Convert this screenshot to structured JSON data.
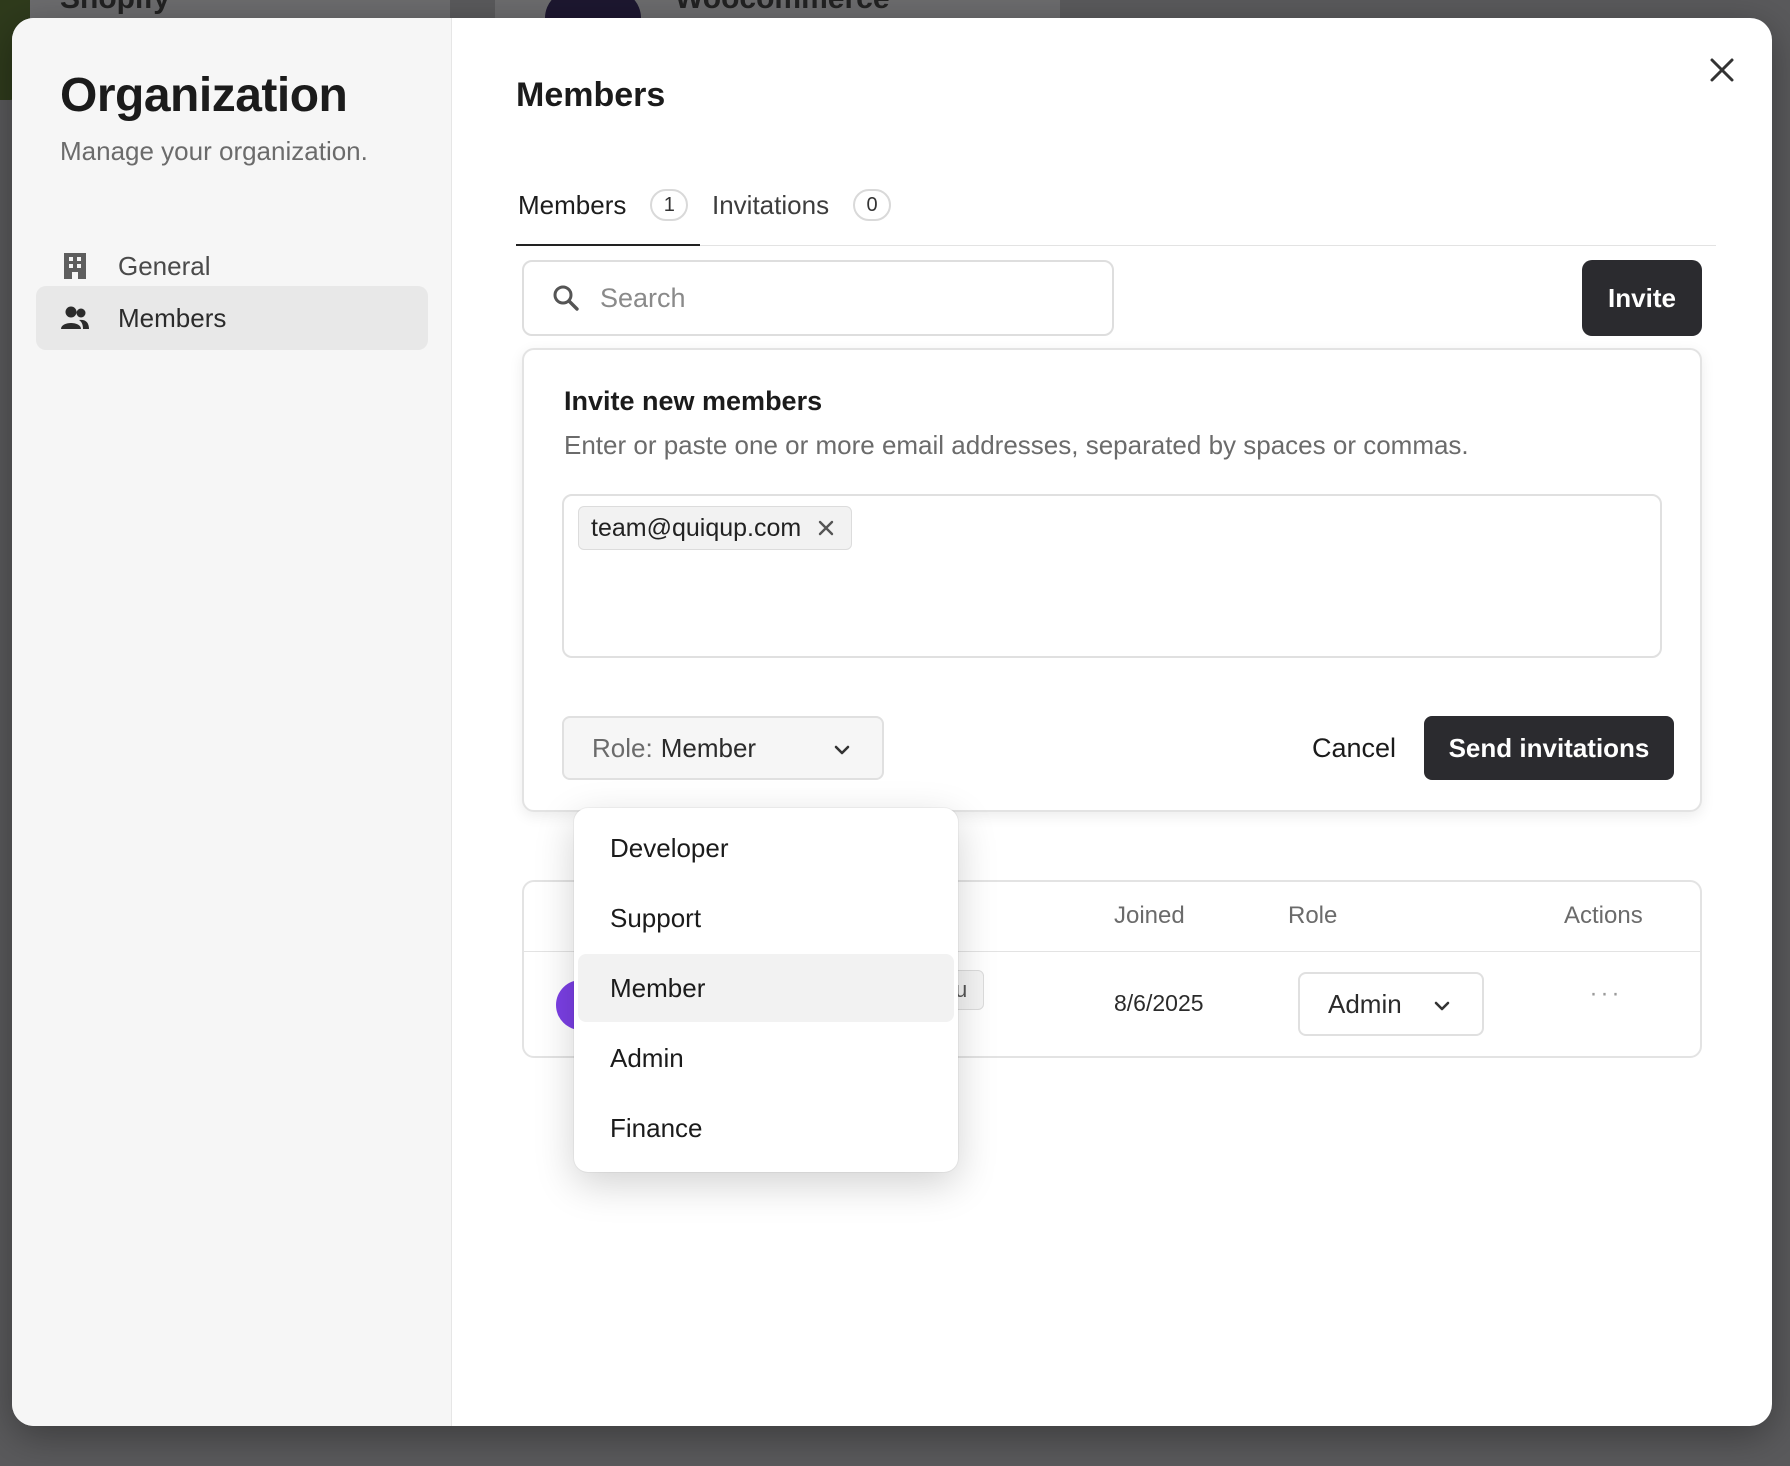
{
  "background": {
    "left_app_name": "Shopify",
    "right_app_name": "Woocommerce"
  },
  "sidebar": {
    "title": "Organization",
    "subtitle": "Manage your organization.",
    "items": [
      {
        "label": "General",
        "icon": "building-icon",
        "active": false
      },
      {
        "label": "Members",
        "icon": "users-icon",
        "active": true
      }
    ]
  },
  "main": {
    "title": "Members",
    "tabs": [
      {
        "label": "Members",
        "count": "1",
        "active": true
      },
      {
        "label": "Invitations",
        "count": "0",
        "active": false
      }
    ],
    "search_placeholder": "Search",
    "invite_label": "Invite"
  },
  "invite_panel": {
    "title": "Invite new members",
    "description": "Enter or paste one or more email addresses, separated by spaces or commas.",
    "emails": [
      "team@quiqup.com"
    ],
    "role_key": "Role:",
    "role_value": "Member",
    "cancel_label": "Cancel",
    "send_label": "Send invitations"
  },
  "table": {
    "headers": {
      "joined": "Joined",
      "role": "Role",
      "actions": "Actions"
    },
    "rows": [
      {
        "badge": "u",
        "joined": "8/6/2025",
        "role": "Admin",
        "actions": "···"
      }
    ]
  },
  "role_dropdown": {
    "options": [
      "Developer",
      "Support",
      "Member",
      "Admin",
      "Finance"
    ],
    "highlighted": "Member"
  },
  "colors": {
    "primary_button": "#2b2b2f",
    "avatar": "#7b3fe4",
    "sidebar_bg": "#f6f6f6"
  }
}
